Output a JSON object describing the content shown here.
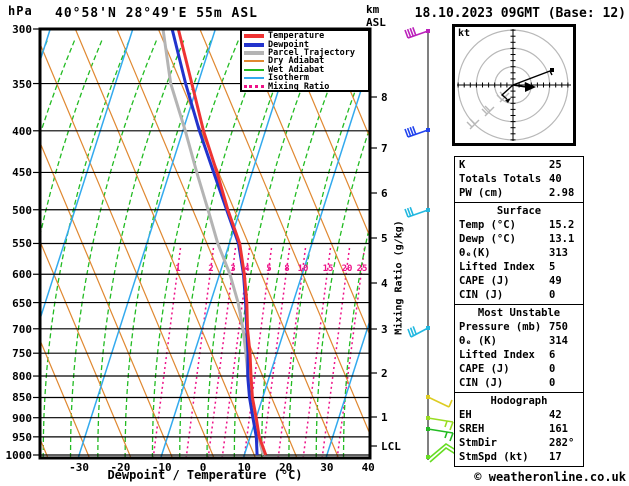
{
  "header": {
    "hpa_label": "hPa",
    "title": "40°58'N 28°49'E 55m ASL",
    "km_label": "km",
    "asl_label": "ASL",
    "date": "18.10.2023 09GMT (Base: 12)"
  },
  "legend": [
    {
      "label": "Temperature",
      "color": "#ee3333",
      "thick": true,
      "style": "solid"
    },
    {
      "label": "Dewpoint",
      "color": "#2233cc",
      "thick": true,
      "style": "solid"
    },
    {
      "label": "Parcel Trajectory",
      "color": "#b4b4b4",
      "thick": true,
      "style": "solid"
    },
    {
      "label": "Dry Adiabat",
      "color": "#e08830",
      "thick": false,
      "style": "solid"
    },
    {
      "label": "Wet Adiabat",
      "color": "#22bb22",
      "thick": false,
      "style": "solid"
    },
    {
      "label": "Isotherm",
      "color": "#33aaee",
      "thick": false,
      "style": "solid"
    },
    {
      "label": "Mixing Ratio",
      "color": "#ee1188",
      "thick": false,
      "style": "dotted"
    }
  ],
  "hodograph": {
    "unit_label": "kt",
    "rings_kt": [
      15,
      30,
      45
    ],
    "tick_step_kt": 5
  },
  "panel": {
    "sections": [
      {
        "header": null,
        "rows": [
          [
            "K",
            "25"
          ],
          [
            "Totals Totals",
            "40"
          ],
          [
            "PW (cm)",
            "2.98"
          ]
        ]
      },
      {
        "header": "Surface",
        "rows": [
          [
            "Temp (°C)",
            "15.2"
          ],
          [
            "Dewp (°C)",
            "13.1"
          ],
          [
            "θₑ(K)",
            "313"
          ],
          [
            "Lifted Index",
            "5"
          ],
          [
            "CAPE (J)",
            "49"
          ],
          [
            "CIN (J)",
            "0"
          ]
        ]
      },
      {
        "header": "Most Unstable",
        "rows": [
          [
            "Pressure (mb)",
            "750"
          ],
          [
            "θₑ (K)",
            "314"
          ],
          [
            "Lifted Index",
            "6"
          ],
          [
            "CAPE (J)",
            "0"
          ],
          [
            "CIN (J)",
            "0"
          ]
        ]
      },
      {
        "header": "Hodograph",
        "rows": [
          [
            "EH",
            "42"
          ],
          [
            "SREH",
            "161"
          ],
          [
            "StmDir",
            "282°"
          ],
          [
            "StmSpd (kt)",
            "17"
          ]
        ]
      }
    ]
  },
  "footer": {
    "copyright": "© weatheronline.co.uk"
  },
  "chart_data": {
    "type": "skew-t-log-p-sounding",
    "pressure_axis": {
      "label": "hPa",
      "ticks": [
        300,
        350,
        400,
        450,
        500,
        550,
        600,
        650,
        700,
        750,
        800,
        850,
        900,
        950,
        1000
      ]
    },
    "temp_axis": {
      "label": "Dewpoint / Temperature (°C)",
      "ticks": [
        -30,
        -20,
        -10,
        0,
        10,
        20,
        30,
        40
      ]
    },
    "altitude_axis": {
      "unit": "km",
      "ticks_km": [
        8,
        7,
        6,
        5,
        4,
        3,
        2,
        1
      ],
      "lcl_label": "LCL"
    },
    "mixing_ratio_axis": {
      "label": "Mixing Ratio (g/kg)",
      "line_labels": [
        1,
        2,
        3,
        4,
        5,
        8,
        10,
        15,
        20,
        25
      ]
    },
    "series": [
      {
        "name": "Temperature",
        "color": "#ee3333",
        "points_p_t": [
          [
            300,
            -39.0
          ],
          [
            350,
            -31.5
          ],
          [
            400,
            -25.0
          ],
          [
            450,
            -18.5
          ],
          [
            500,
            -13.0
          ],
          [
            550,
            -7.5
          ],
          [
            600,
            -4.0
          ],
          [
            650,
            -1.2
          ],
          [
            700,
            1.0
          ],
          [
            750,
            3.5
          ],
          [
            800,
            5.5
          ],
          [
            850,
            7.5
          ],
          [
            900,
            10.0
          ],
          [
            950,
            12.2
          ],
          [
            1000,
            15.2
          ]
        ]
      },
      {
        "name": "Dewpoint",
        "color": "#2233cc",
        "points_p_t": [
          [
            300,
            -40.5
          ],
          [
            350,
            -33.0
          ],
          [
            400,
            -26.0
          ],
          [
            450,
            -19.3
          ],
          [
            500,
            -13.3
          ],
          [
            550,
            -7.8
          ],
          [
            600,
            -4.2
          ],
          [
            650,
            -1.5
          ],
          [
            700,
            0.8
          ],
          [
            750,
            3.0
          ],
          [
            800,
            4.7
          ],
          [
            850,
            6.8
          ],
          [
            900,
            9.2
          ],
          [
            950,
            11.5
          ],
          [
            1000,
            13.1
          ]
        ]
      },
      {
        "name": "Parcel Trajectory",
        "color": "#b4b4b4",
        "points_p_t": [
          [
            300,
            -42.7
          ],
          [
            350,
            -36.6
          ],
          [
            400,
            -29.4
          ],
          [
            450,
            -23.4
          ],
          [
            500,
            -17.8
          ],
          [
            550,
            -12.8
          ],
          [
            600,
            -7.5
          ],
          [
            650,
            -3.3
          ],
          [
            700,
            -0.1
          ],
          [
            750,
            2.5
          ],
          [
            800,
            4.8
          ],
          [
            850,
            7.2
          ],
          [
            900,
            9.5
          ],
          [
            950,
            12.0
          ],
          [
            1000,
            14.6
          ]
        ]
      }
    ],
    "background": {
      "isotherms_c": [
        -110,
        -90,
        -70,
        -50,
        -30,
        -10,
        10,
        30
      ],
      "isotherm_color": "#33aaee",
      "dry_adiabat_color": "#e08830",
      "wet_adiabat_color": "#22bb22",
      "mixing_ratio_color": "#ee1188"
    },
    "wind_barbs": [
      {
        "level": "300hPa",
        "color": "#bb22bb",
        "y": 31,
        "kind": "upper-left-4"
      },
      {
        "level": "400hPa",
        "color": "#2244ee",
        "y": 130,
        "kind": "upper-left-4"
      },
      {
        "level": "500hPa",
        "color": "#22b8e0",
        "y": 210,
        "kind": "upper-left-3"
      },
      {
        "level": "700hPa",
        "color": "#22b8e0",
        "y": 328,
        "kind": "lower-left-2"
      },
      {
        "level": "850hPa",
        "color": "#ddcc22",
        "y": 397,
        "kind": "lower-right-1"
      },
      {
        "level": "900hPa",
        "color": "#99dd22",
        "y": 418,
        "kind": "right-hook"
      },
      {
        "level": "925hPa",
        "color": "#22bb22",
        "y": 429,
        "kind": "right-hook"
      },
      {
        "level": "1000hPa",
        "color": "#66dd22",
        "y": 457,
        "kind": "double-chevron"
      }
    ]
  }
}
